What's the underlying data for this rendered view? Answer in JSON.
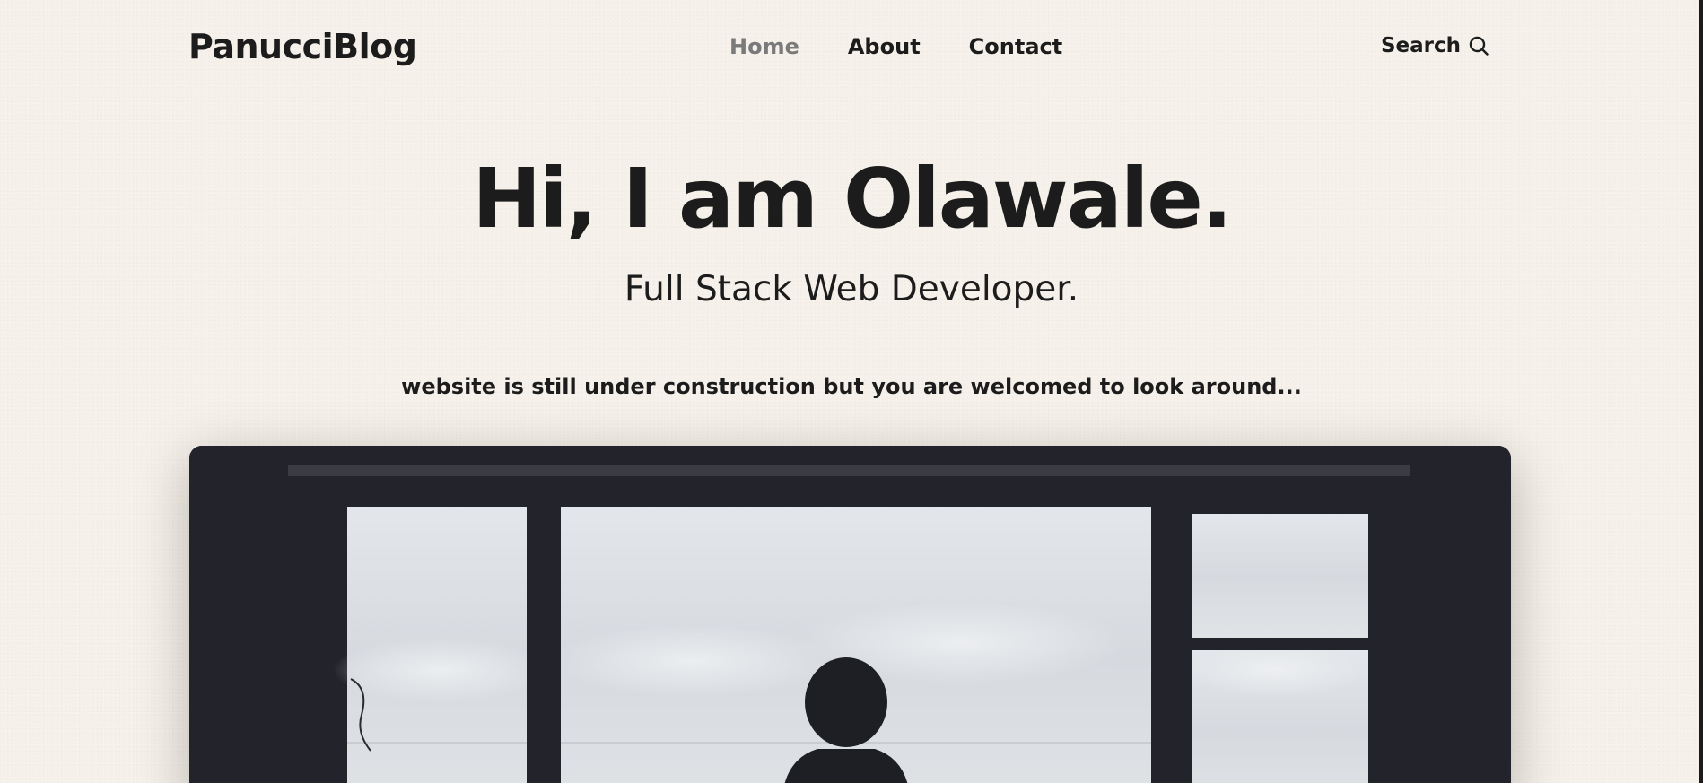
{
  "header": {
    "logo": "PanucciBlog",
    "nav": [
      {
        "label": "Home",
        "active": true
      },
      {
        "label": "About",
        "active": false
      },
      {
        "label": "Contact",
        "active": false
      }
    ],
    "search_label": "Search",
    "search_icon": "search-icon"
  },
  "hero": {
    "title": "Hi, I am Olawale.",
    "subtitle": "Full Stack Web Developer.",
    "notice": "website is still under construction but you are welcomed to look around..."
  },
  "colors": {
    "background": "#f6f1ea",
    "text": "#1c1c1c",
    "nav_active": "#7a7a7a",
    "image_frame": "#23232b"
  }
}
